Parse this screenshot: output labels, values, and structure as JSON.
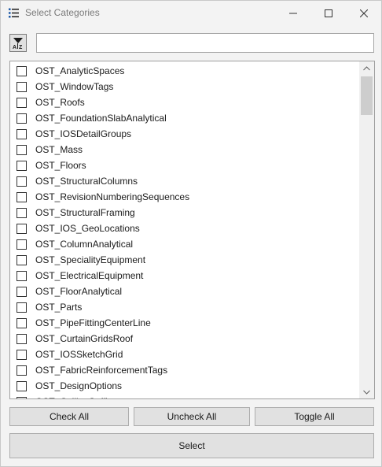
{
  "window": {
    "title": "Select Categories",
    "icon": "list-icon"
  },
  "search": {
    "value": "",
    "placeholder": ""
  },
  "sort_button": {
    "icon": "sort-alpha-icon",
    "glyph_top": "A",
    "glyph_bottom": "Z"
  },
  "categories": [
    {
      "label": "OST_AnalyticSpaces",
      "checked": false
    },
    {
      "label": "OST_WindowTags",
      "checked": false
    },
    {
      "label": "OST_Roofs",
      "checked": false
    },
    {
      "label": "OST_FoundationSlabAnalytical",
      "checked": false
    },
    {
      "label": "OST_IOSDetailGroups",
      "checked": false
    },
    {
      "label": "OST_Mass",
      "checked": false
    },
    {
      "label": "OST_Floors",
      "checked": false
    },
    {
      "label": "OST_StructuralColumns",
      "checked": false
    },
    {
      "label": "OST_RevisionNumberingSequences",
      "checked": false
    },
    {
      "label": "OST_StructuralFraming",
      "checked": false
    },
    {
      "label": "OST_IOS_GeoLocations",
      "checked": false
    },
    {
      "label": "OST_ColumnAnalytical",
      "checked": false
    },
    {
      "label": "OST_SpecialityEquipment",
      "checked": false
    },
    {
      "label": "OST_ElectricalEquipment",
      "checked": false
    },
    {
      "label": "OST_FloorAnalytical",
      "checked": false
    },
    {
      "label": "OST_Parts",
      "checked": false
    },
    {
      "label": "OST_PipeFittingCenterLine",
      "checked": false
    },
    {
      "label": "OST_CurtainGridsRoof",
      "checked": false
    },
    {
      "label": "OST_IOSSketchGrid",
      "checked": false
    },
    {
      "label": "OST_FabricReinforcementTags",
      "checked": false
    },
    {
      "label": "OST_DesignOptions",
      "checked": false
    },
    {
      "label": "OST_CeilingSoffit",
      "checked": false
    }
  ],
  "buttons": {
    "check_all": "Check All",
    "uncheck_all": "Uncheck All",
    "toggle_all": "Toggle All",
    "select": "Select"
  },
  "colors": {
    "button_bg": "#e1e1e1",
    "window_bg": "#f3f3f3",
    "scroll_thumb": "#cdcdcd"
  }
}
